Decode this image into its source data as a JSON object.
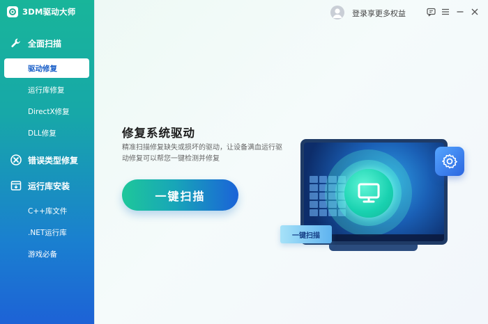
{
  "app": {
    "title": "3DM驱动大师"
  },
  "sidebar": {
    "groups": [
      {
        "label": "全面扫描",
        "icon": "wrench-icon"
      },
      {
        "label": "错误类型修复",
        "icon": "x-repair-icon"
      },
      {
        "label": "运行库安装",
        "icon": "install-icon"
      }
    ],
    "items": [
      {
        "label": "驱动修复",
        "active": true
      },
      {
        "label": "运行库修复",
        "active": false
      },
      {
        "label": "DirectX修复",
        "active": false
      },
      {
        "label": "DLL修复",
        "active": false
      },
      {
        "label": "C++库文件",
        "active": false
      },
      {
        "label": ".NET运行库",
        "active": false
      },
      {
        "label": "游戏必备",
        "active": false
      }
    ]
  },
  "topbar": {
    "login_label": "登录享更多权益",
    "icons": [
      "avatar-icon",
      "feedback-icon",
      "menu-icon",
      "minimize-icon",
      "close-icon"
    ]
  },
  "main": {
    "headline": "修复系统驱动",
    "description": "精准扫描修复缺失或损坏的驱动，让设备满血运行驱动修复可以帮您一键检测并修复",
    "scan_button": "一键扫描",
    "illustration_button": "一键扫描"
  },
  "colors": {
    "sidebar_top": "#18b59a",
    "sidebar_bottom": "#1d62d6",
    "active_text": "#1a5fc8",
    "button_start": "#1ec79a",
    "button_end": "#1a63d8"
  }
}
